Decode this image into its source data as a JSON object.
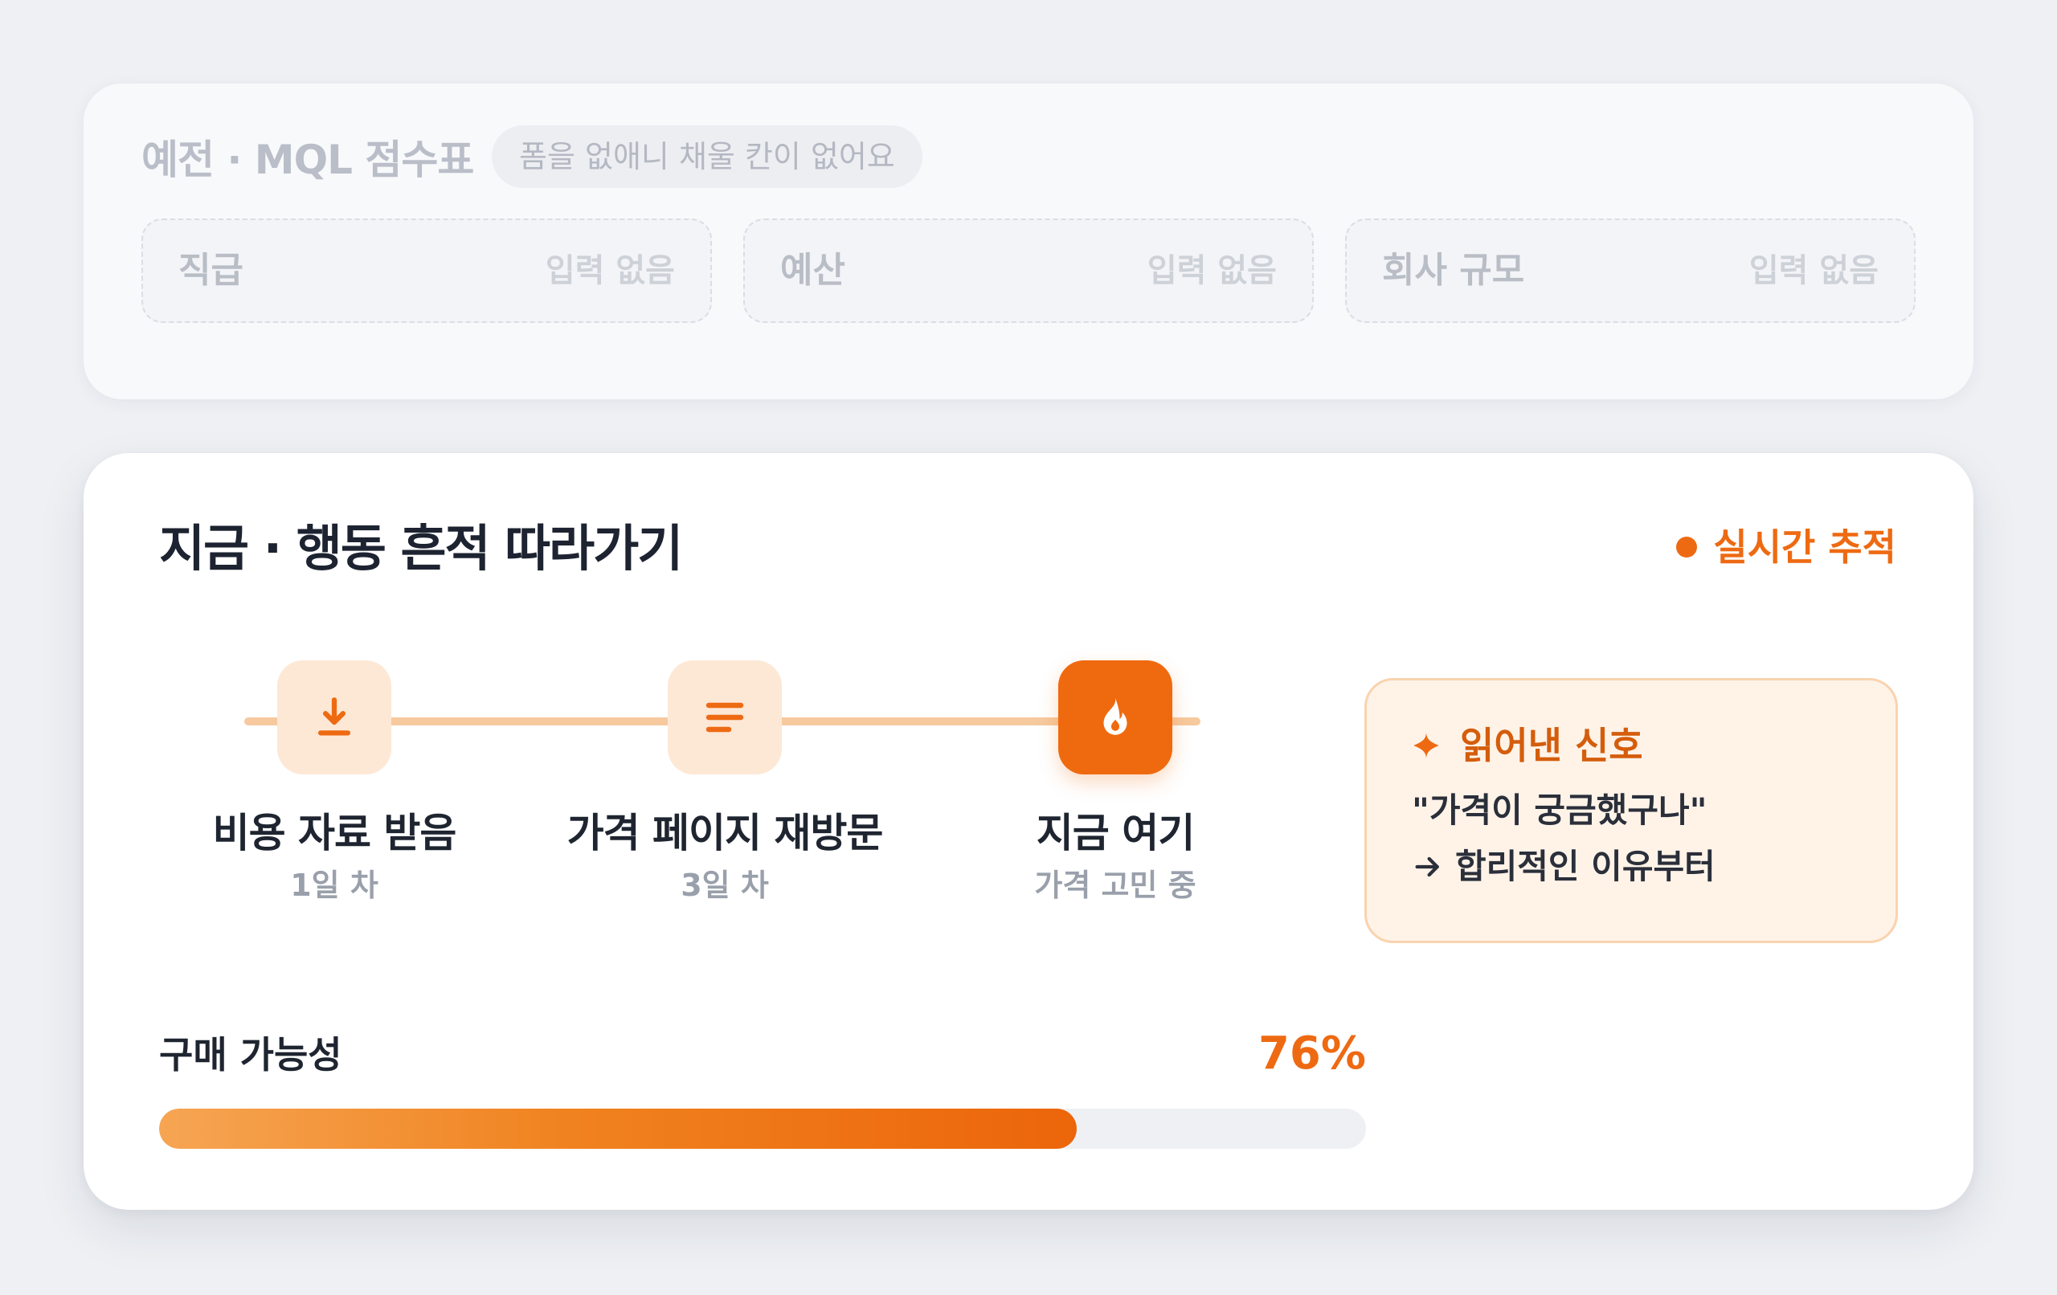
{
  "legacy": {
    "title": "예전 · MQL 점수표",
    "badge": "폼을 없애니 채울 칸이 없어요",
    "fields": [
      {
        "label": "직급",
        "value": "입력 없음"
      },
      {
        "label": "예산",
        "value": "입력 없음"
      },
      {
        "label": "회사 규모",
        "value": "입력 없음"
      }
    ]
  },
  "main": {
    "title": "지금 · 행동 흔적 따라가기",
    "live_label": "실시간 추적",
    "steps": [
      {
        "label": "비용 자료 받음",
        "sub": "1일 차",
        "icon": "download-icon"
      },
      {
        "label": "가격 페이지 재방문",
        "sub": "3일 차",
        "icon": "lines-icon"
      },
      {
        "label": "지금 여기",
        "sub": "가격 고민 중",
        "icon": "flame-icon"
      }
    ],
    "signal": {
      "title": "읽어낸 신호",
      "quote": "\"가격이 궁금했구나\"",
      "action": "합리적인 이유부터"
    },
    "probability": {
      "label": "구매 가능성",
      "value_text": "76%",
      "value": 0.76
    }
  },
  "colors": {
    "accent": "#ee6a12",
    "accent_soft": "#fde8d6",
    "track": "#f6c99e",
    "signal_bg": "#fff3e8"
  }
}
